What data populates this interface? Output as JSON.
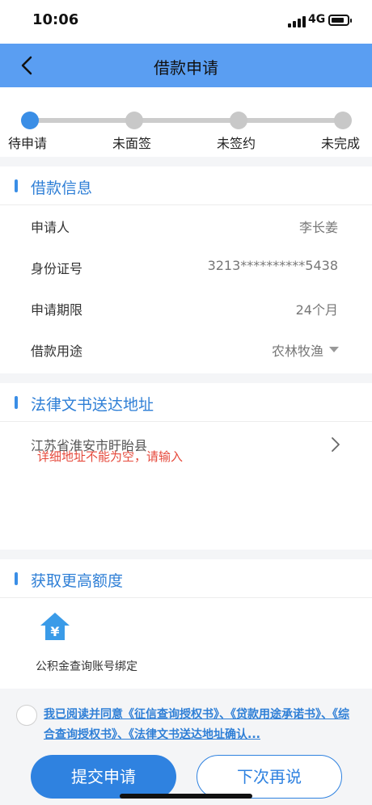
{
  "status": {
    "time": "10:06",
    "network": "4G"
  },
  "nav": {
    "title": "借款申请"
  },
  "steps": [
    {
      "label": "待申请",
      "active": true
    },
    {
      "label": "未面签",
      "active": false
    },
    {
      "label": "未签约",
      "active": false
    },
    {
      "label": "未完成",
      "active": false
    }
  ],
  "loan_info": {
    "title": "借款信息",
    "rows": [
      {
        "label": "申请人",
        "value": "李长姜"
      },
      {
        "label": "身份证号",
        "value": "3213**********5438"
      },
      {
        "label": "申请期限",
        "value": "24个月"
      },
      {
        "label": "借款用途",
        "value": "农林牧渔"
      }
    ]
  },
  "address": {
    "title": "法律文书送达地址",
    "value": "江苏省淮安市盱眙县",
    "error": "详细地址不能为空，请输入"
  },
  "quota": {
    "title": "获取更高额度",
    "fund_label": "公积金查询账号绑定",
    "fund_icon_glyph": "¥"
  },
  "agreement": {
    "text": "我已阅读并同意《征信查询授权书》、《贷款用途承诺书》、《综合查询授权书》、《法律文书送达地址确认..."
  },
  "buttons": {
    "submit": "提交申请",
    "later": "下次再说"
  },
  "colors": {
    "accent": "#2f82e0",
    "nav_bg": "#5a9ef2",
    "error": "#e64a3c"
  }
}
